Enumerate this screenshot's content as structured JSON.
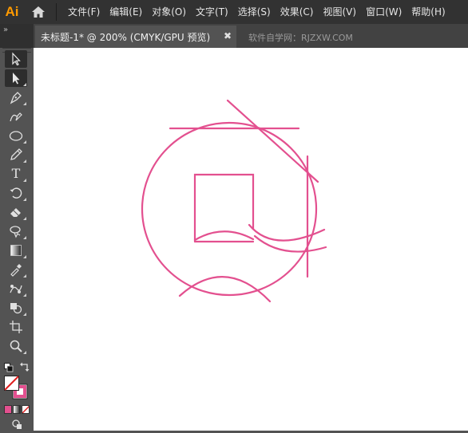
{
  "app": {
    "logo": "Ai"
  },
  "menu": {
    "items": [
      "文件(F)",
      "编辑(E)",
      "对象(O)",
      "文字(T)",
      "选择(S)",
      "效果(C)",
      "视图(V)",
      "窗口(W)",
      "帮助(H)"
    ]
  },
  "tabs": {
    "collapse_glyph": "»",
    "document_title": "未标题-1* @ 200% (CMYK/GPU 预览)",
    "close_glyph": "✖",
    "watermark": "软件自学网：RJZXW.COM"
  },
  "toolbar": {
    "tools": [
      "selection-icon",
      "direct-selection-icon",
      "pen-icon",
      "curvature-icon",
      "ellipse-icon",
      "pencil-icon",
      "type-icon",
      "rotate-icon",
      "eraser-icon",
      "lasso-icon",
      "gradient-icon",
      "eyedropper-icon",
      "blend-icon",
      "shape-builder-icon",
      "artboard-icon",
      "zoom-icon"
    ],
    "type_glyph": "T"
  },
  "colors": {
    "stroke": "#e3508f",
    "menubar_bg": "#323232",
    "panel_bg": "#535353",
    "canvas_bg": "#ffffff"
  }
}
